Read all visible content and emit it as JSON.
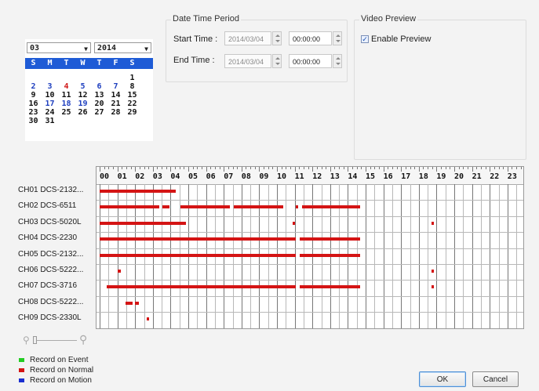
{
  "calendar": {
    "month": "03",
    "year": "2014",
    "weekdays": [
      "S",
      "M",
      "T",
      "W",
      "T",
      "F",
      "S"
    ],
    "weeks": [
      [
        "",
        "",
        "",
        "",
        "",
        "",
        "1"
      ],
      [
        "2",
        "3",
        "4",
        "5",
        "6",
        "7",
        "8"
      ],
      [
        "9",
        "10",
        "11",
        "12",
        "13",
        "14",
        "15"
      ],
      [
        "16",
        "17",
        "18",
        "19",
        "20",
        "21",
        "22"
      ],
      [
        "23",
        "24",
        "25",
        "26",
        "27",
        "28",
        "29"
      ],
      [
        "30",
        "31",
        "",
        "",
        "",
        "",
        ""
      ]
    ]
  },
  "date_time_period": {
    "title": "Date Time Period",
    "start_label": "Start Time :",
    "start_date": "2014/03/04",
    "start_time": "00:00:00",
    "end_label": "End Time :",
    "end_date": "2014/03/04",
    "end_time": "00:00:00"
  },
  "video_preview": {
    "title": "Video Preview",
    "enable_label": "Enable Preview",
    "enable_checked": true
  },
  "timeline": {
    "hours": [
      "00",
      "01",
      "02",
      "03",
      "04",
      "05",
      "06",
      "07",
      "08",
      "09",
      "10",
      "11",
      "12",
      "13",
      "14",
      "15",
      "16",
      "17",
      "18",
      "19",
      "20",
      "21",
      "22",
      "23"
    ],
    "channels": [
      {
        "label": "CH01 DCS-2132...",
        "segments": [
          [
            0,
            4.3
          ]
        ]
      },
      {
        "label": "CH02 DCS-6511",
        "segments": [
          [
            0,
            3.35
          ],
          [
            3.55,
            3.95
          ],
          [
            4.55,
            7.35
          ],
          [
            7.55,
            10.35
          ],
          [
            11.05,
            11.15
          ],
          [
            11.4,
            14.7
          ]
        ]
      },
      {
        "label": "CH03 DCS-5020L",
        "segments": [
          [
            0,
            4.85
          ],
          [
            10.9,
            11.0
          ],
          [
            18.7,
            18.8
          ]
        ]
      },
      {
        "label": "CH04 DCS-2230",
        "segments": [
          [
            0,
            11.05
          ],
          [
            11.3,
            14.7
          ]
        ]
      },
      {
        "label": "CH05 DCS-2132...",
        "segments": [
          [
            0,
            11.05
          ],
          [
            11.3,
            14.7
          ]
        ]
      },
      {
        "label": "CH06 DCS-5222...",
        "segments": [
          [
            1.0,
            1.2
          ],
          [
            18.7,
            18.8
          ]
        ]
      },
      {
        "label": "CH07 DCS-3716",
        "segments": [
          [
            0.4,
            11.05
          ],
          [
            11.3,
            14.7
          ],
          [
            18.7,
            18.8
          ]
        ]
      },
      {
        "label": "CH08 DCS-5222...",
        "segments": [
          [
            1.45,
            1.85
          ],
          [
            2.0,
            2.2
          ]
        ]
      },
      {
        "label": "CH09 DCS-2330L",
        "segments": [
          [
            2.65,
            2.75
          ]
        ]
      }
    ]
  },
  "legend": [
    {
      "label": "Record on Event",
      "color": "#22cc22"
    },
    {
      "label": "Record on Normal",
      "color": "#d41414"
    },
    {
      "label": "Record on Motion",
      "color": "#1a2fd0"
    }
  ],
  "buttons": {
    "ok": "OK",
    "cancel": "Cancel"
  },
  "icons": {
    "zoom_out": "zoom-out-icon",
    "zoom_in": "zoom-in-icon"
  }
}
